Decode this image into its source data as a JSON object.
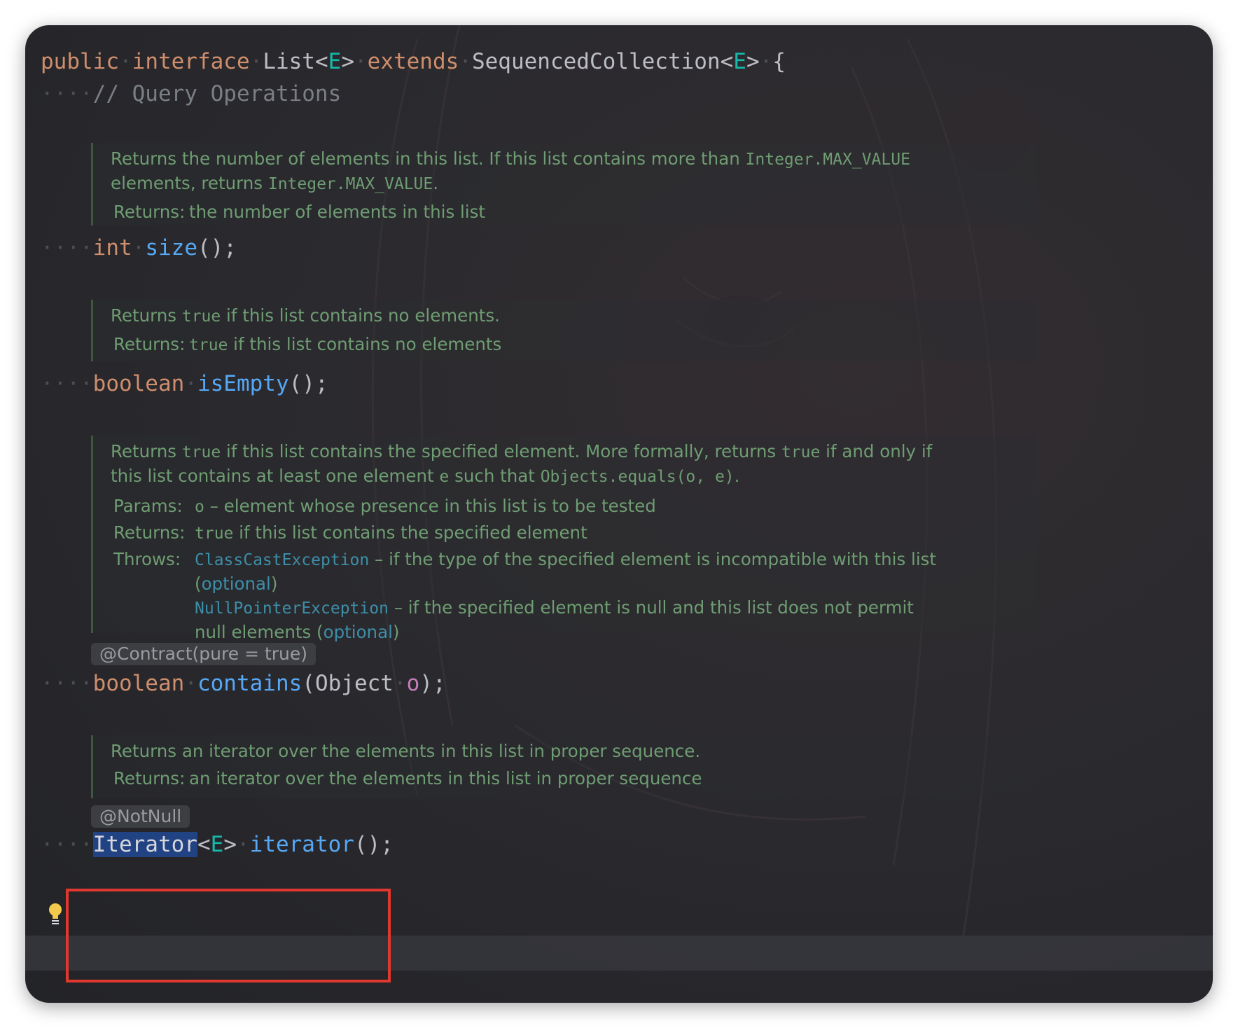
{
  "editor": {
    "line_class_decl": {
      "public": "public",
      "interface": "interface",
      "name": "List",
      "type_param": "E",
      "extends": "extends",
      "super": "SequencedCollection",
      "brace": "{"
    },
    "comment_query": "// Query Operations",
    "size_doc": {
      "desc_a": "Returns the number of elements in this list. If this list contains more than ",
      "desc_code1": "Integer.MAX_VALUE",
      "desc_b": "elements, returns ",
      "desc_code2": "Integer.MAX_VALUE",
      "desc_c": ".",
      "returns_label": "Returns:",
      "returns_text": "the number of elements in this list"
    },
    "size_sig": {
      "type": "int",
      "name": "size",
      "rest": "();"
    },
    "isempty_doc": {
      "desc_a": "Returns ",
      "desc_code": "true",
      "desc_b": " if this list contains no elements.",
      "returns_label": "Returns:",
      "returns_code": "true",
      "returns_text": " if this list contains no elements"
    },
    "isempty_sig": {
      "type": "boolean",
      "name": "isEmpty",
      "rest": "();"
    },
    "contains_doc": {
      "line1_a": "Returns ",
      "line1_code1": "true",
      "line1_b": " if this list contains the specified element. More formally, returns ",
      "line1_code2": "true",
      "line1_c": " if and only if",
      "line2_a": "this list contains at least one element ",
      "line2_code1": "e",
      "line2_b": " such that ",
      "line2_code2": "Objects.equals(o, e)",
      "line2_c": ".",
      "params_label": "Params:",
      "params_code": "o",
      "params_text": " – element whose presence in this list is to be tested",
      "returns_label": "Returns:",
      "returns_code": "true",
      "returns_text": " if this list contains the specified element",
      "throws_label": "Throws:",
      "throws1_link": "ClassCastException",
      "throws1_text": " – if the type of the specified element is incompatible with this list",
      "throws1_paren_open": "(",
      "throws1_optional": "optional",
      "throws1_paren_close": ")",
      "throws2_link": "NullPointerException",
      "throws2_text": " – if the specified element is null and this list does not permit",
      "throws2_text2": "null elements (",
      "throws2_optional": "optional",
      "throws2_paren_close": ")"
    },
    "contract_annotation": "@Contract(pure = true)",
    "contains_sig": {
      "type": "boolean",
      "name": "contains",
      "open": "(",
      "param_type": "Object",
      "param_name": "o",
      "close": ");"
    },
    "iterator_doc": {
      "desc": "Returns an iterator over the elements in this list in proper sequence.",
      "returns_label": "Returns:",
      "returns_text": "an iterator over the elements in this list in proper sequence"
    },
    "notnull_annotation": "@NotNull",
    "iterator_sig": {
      "type": "Iterator",
      "lt": "<",
      "type_param": "E",
      "gt": ">",
      "name": "iterator",
      "rest": "();"
    }
  },
  "colors": {
    "keyword": "#cf8e6d",
    "type_param": "#16baac",
    "method": "#56a8f5",
    "doc_text": "#6f9d73",
    "highlight_box": "#e0382e",
    "selection": "#214283"
  },
  "icons": [
    "lightbulb-icon"
  ]
}
